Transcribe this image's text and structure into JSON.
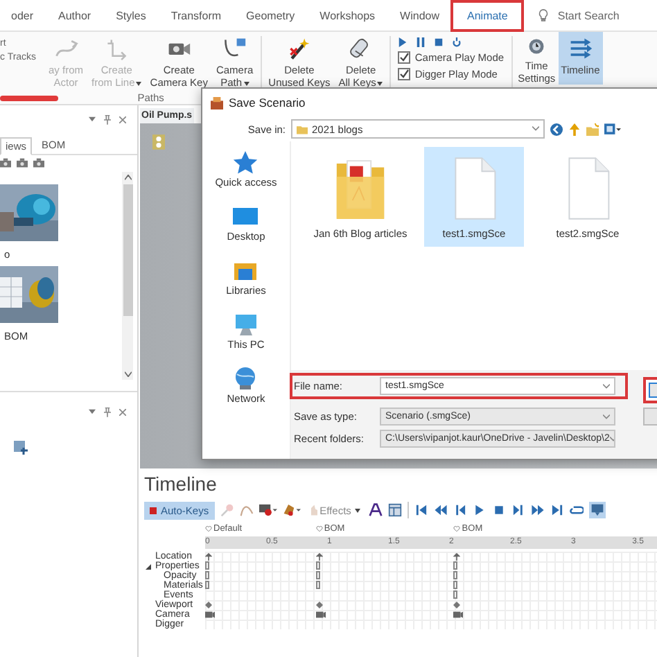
{
  "menu_tabs": [
    {
      "label": "oder",
      "selected": false,
      "highlighted": false
    },
    {
      "label": "Author",
      "selected": false,
      "highlighted": false
    },
    {
      "label": "Styles",
      "selected": false,
      "highlighted": false
    },
    {
      "label": "Transform",
      "selected": false,
      "highlighted": false
    },
    {
      "label": "Geometry",
      "selected": false,
      "highlighted": false
    },
    {
      "label": "Workshops",
      "selected": false,
      "highlighted": false
    },
    {
      "label": "Window",
      "selected": false,
      "highlighted": false
    },
    {
      "label": "Animate",
      "selected": true,
      "highlighted": true
    }
  ],
  "search": {
    "placeholder": "Start Search"
  },
  "ribbon": {
    "cut_labels": [
      "rt",
      "c Tracks"
    ],
    "paths_group": {
      "label": "Paths",
      "buttons": [
        {
          "kind": "from-actor",
          "lines": [
            "ay from",
            "Actor"
          ],
          "disabled": true,
          "menu": false
        },
        {
          "kind": "from-line",
          "lines": [
            "Create",
            "from Line"
          ],
          "disabled": true,
          "menu": true
        },
        {
          "kind": "camera-key",
          "lines": [
            "Create",
            "Camera Key"
          ],
          "disabled": false,
          "menu": false
        },
        {
          "kind": "camera-path",
          "lines": [
            "Camera",
            "Path"
          ],
          "disabled": false,
          "menu": true
        }
      ]
    },
    "key_buttons": [
      {
        "kind": "delete-unused",
        "lines": [
          "Delete",
          "Unused Keys"
        ],
        "menu": false
      },
      {
        "kind": "delete-all",
        "lines": [
          "Delete",
          "All Keys"
        ],
        "menu": true
      }
    ],
    "play_modes": [
      {
        "label": "Camera Play Mode",
        "checked": true
      },
      {
        "label": "Digger Play Mode",
        "checked": true
      }
    ],
    "end_buttons": [
      {
        "kind": "time-settings",
        "lines": [
          "Time",
          "Settings"
        ],
        "selected": false
      },
      {
        "kind": "timeline",
        "lines": [
          "Timeline"
        ],
        "selected": true
      }
    ]
  },
  "left_panel": {
    "tabs": [
      {
        "label": "iews",
        "selected": true
      },
      {
        "label": "BOM",
        "selected": false
      }
    ],
    "thumbnails": [
      {
        "label": "o",
        "kind": "picture"
      },
      {
        "label": "BOM",
        "kind": "picture"
      }
    ]
  },
  "document_tab": {
    "title": "Oil Pump.s"
  },
  "dialog": {
    "title": "Save Scenario",
    "save_in": {
      "label": "Save in:",
      "value": "2021 blogs"
    },
    "places": [
      {
        "kind": "quick-access",
        "label": "Quick access"
      },
      {
        "kind": "desktop",
        "label": "Desktop"
      },
      {
        "kind": "libraries",
        "label": "Libraries"
      },
      {
        "kind": "this-pc",
        "label": "This PC"
      },
      {
        "kind": "network",
        "label": "Network"
      }
    ],
    "files": [
      {
        "kind": "folder",
        "name": "Jan 6th Blog articles",
        "selected": false
      },
      {
        "kind": "file",
        "name": "test1.smgSce",
        "selected": true
      },
      {
        "kind": "file",
        "name": "test2.smgSce",
        "selected": false
      }
    ],
    "fields": [
      {
        "kind": "input",
        "label": "File name:",
        "value": "test1.smgSce",
        "highlighted": true
      },
      {
        "kind": "combo",
        "label": "Save as type:",
        "value": "Scenario (.smgSce)",
        "highlighted": false
      },
      {
        "kind": "combo",
        "label": "Recent folders:",
        "value": "C:\\Users\\vipanjot.kaur\\OneDrive - Javelin\\Desktop\\2",
        "highlighted": false
      }
    ],
    "save_button_highlighted": true
  },
  "timeline": {
    "title": "Timeline",
    "auto_keys": {
      "label": "Auto-Keys",
      "selected": true
    },
    "effects": {
      "label": "Effects"
    },
    "filter_selected": true,
    "markers": [
      "Default",
      "BOM",
      "BOM"
    ],
    "ruler": [
      "0",
      "0.5",
      "1",
      "1.5",
      "2",
      "2.5",
      "3",
      "3.5"
    ],
    "tracks": [
      {
        "label": "Location",
        "kind": "pin"
      },
      {
        "label": "Properties",
        "kind": "bar",
        "expanded": true,
        "children": [
          {
            "label": "Opacity",
            "kind": "bar"
          },
          {
            "label": "Materials",
            "kind": "bar"
          },
          {
            "label": "Events",
            "kind": "event"
          }
        ]
      },
      {
        "label": "Viewport",
        "kind": "diamond"
      },
      {
        "label": "Camera",
        "kind": "camera"
      },
      {
        "label": "Digger",
        "kind": "none"
      }
    ]
  }
}
